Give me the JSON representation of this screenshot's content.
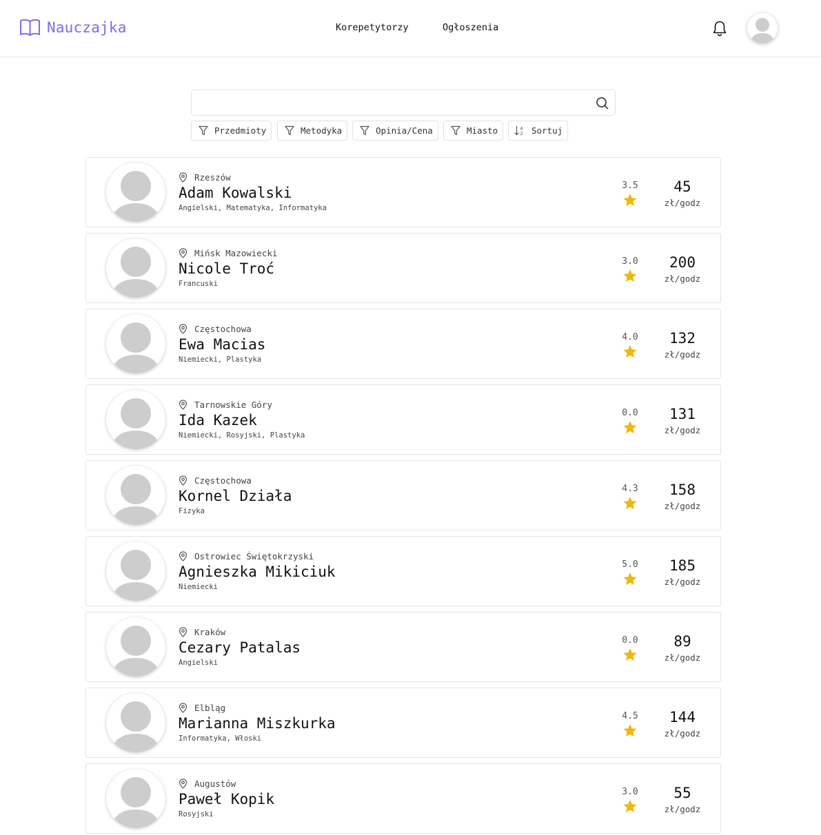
{
  "app": {
    "name": "Nauczajka",
    "brand_color": "#7b6cf0",
    "star_color": "#f0b70e"
  },
  "nav": [
    {
      "label": "Korepetytorzy"
    },
    {
      "label": "Ogłoszenia"
    }
  ],
  "header_icons": [
    "bell-icon",
    "user-avatar"
  ],
  "search": {
    "value": "",
    "placeholder": ""
  },
  "filters": [
    {
      "label": "Przedmioty",
      "icon": "filter-icon"
    },
    {
      "label": "Metodyka",
      "icon": "filter-icon"
    },
    {
      "label": "Opinia/Cena",
      "icon": "filter-icon"
    },
    {
      "label": "Miasto",
      "icon": "filter-icon"
    },
    {
      "label": "Sortuj",
      "icon": "sort-az-icon"
    }
  ],
  "tutors": [
    {
      "city": "Rzeszów",
      "name": "Adam Kowalski",
      "subjects": "Angielski, Matematyka, Informatyka",
      "rating": "3.5",
      "price": "45",
      "unit": "zł/godz"
    },
    {
      "city": "Mińsk Mazowiecki",
      "name": "Nicole Troć",
      "subjects": "Francuski",
      "rating": "3.0",
      "price": "200",
      "unit": "zł/godz"
    },
    {
      "city": "Częstochowa",
      "name": "Ewa Macias",
      "subjects": "Niemiecki, Plastyka",
      "rating": "4.0",
      "price": "132",
      "unit": "zł/godz"
    },
    {
      "city": "Tarnowskie Góry",
      "name": "Ida Kazek",
      "subjects": "Niemiecki, Rosyjski, Plastyka",
      "rating": "0.0",
      "price": "131",
      "unit": "zł/godz"
    },
    {
      "city": "Częstochowa",
      "name": "Kornel Działa",
      "subjects": "Fizyka",
      "rating": "4.3",
      "price": "158",
      "unit": "zł/godz"
    },
    {
      "city": "Ostrowiec Świętokrzyski",
      "name": "Agnieszka Mikiciuk",
      "subjects": "Niemiecki",
      "rating": "5.0",
      "price": "185",
      "unit": "zł/godz"
    },
    {
      "city": "Kraków",
      "name": "Cezary Patalas",
      "subjects": "Angielski",
      "rating": "0.0",
      "price": "89",
      "unit": "zł/godz"
    },
    {
      "city": "Elbląg",
      "name": "Marianna Miszkurka",
      "subjects": "Informatyka, Włoski",
      "rating": "4.5",
      "price": "144",
      "unit": "zł/godz"
    },
    {
      "city": "Augustów",
      "name": "Paweł Kopik",
      "subjects": "Rosyjski",
      "rating": "3.0",
      "price": "55",
      "unit": "zł/godz"
    }
  ]
}
